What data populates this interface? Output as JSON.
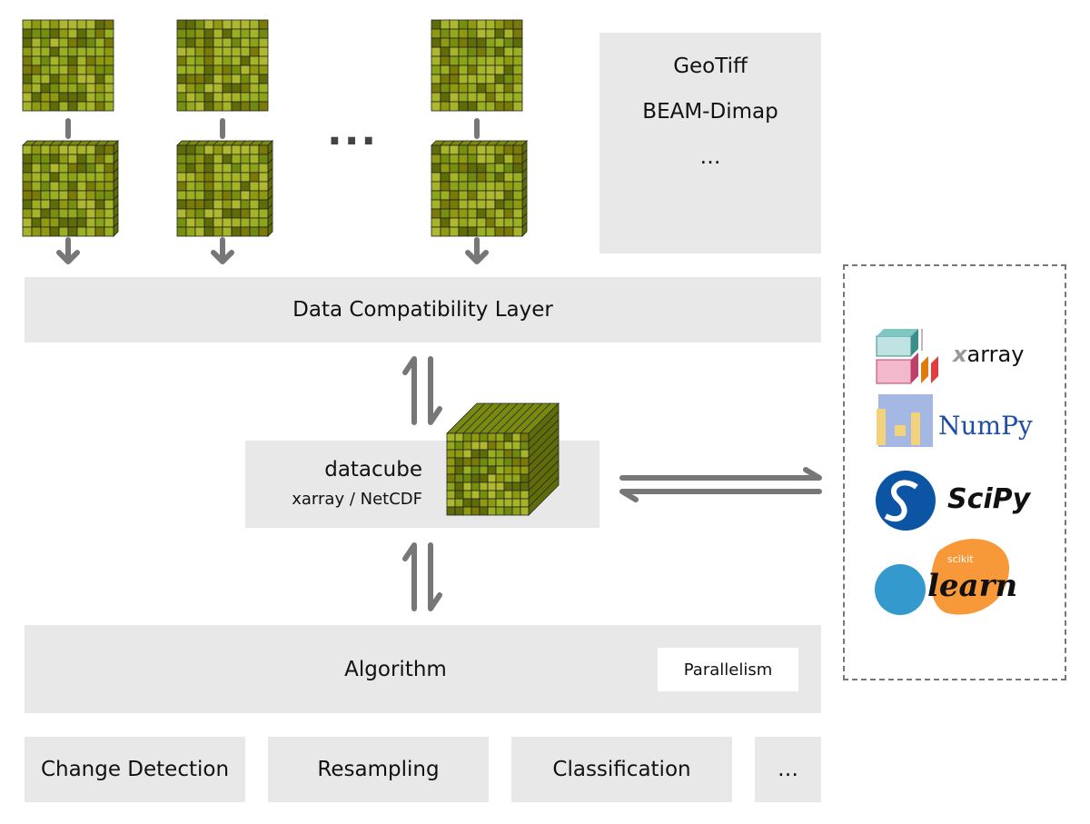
{
  "inputs": {
    "ellipsis": "···",
    "tiles": 3
  },
  "formats": {
    "items": [
      "GeoTiff",
      "BEAM-Dimap",
      "…"
    ]
  },
  "compat_layer": {
    "label": "Data Compatibility Layer"
  },
  "datacube": {
    "title": "datacube",
    "subtitle": "xarray / NetCDF"
  },
  "libraries": {
    "items": [
      {
        "name": "xarray",
        "icon": "xarray-logo"
      },
      {
        "name": "NumPy",
        "icon": "numpy-logo",
        "color": "#1f4ea3"
      },
      {
        "name": "SciPy",
        "icon": "scipy-logo",
        "color": "#0c55a5"
      },
      {
        "name": "learn",
        "prefix": "scikit",
        "icon": "scikit-learn-logo",
        "colors": [
          "#3499cd",
          "#f89939"
        ]
      }
    ]
  },
  "algorithm": {
    "label": "Algorithm",
    "parallelism": "Parallelism"
  },
  "applications": [
    "Change Detection",
    "Resampling",
    "Classification",
    "…"
  ],
  "colors": {
    "box": "#e8e8e8",
    "arrow": "#777777",
    "grid": "#7a8a10"
  }
}
